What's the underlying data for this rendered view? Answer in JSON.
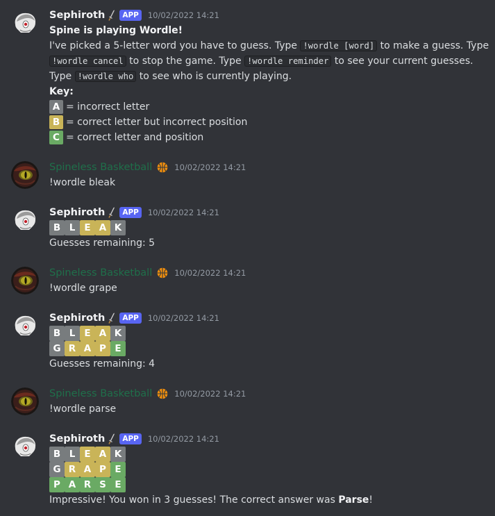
{
  "colors": {
    "background": "#313338",
    "app_badge": "#5865f2",
    "tile_incorrect": "#787c7e",
    "tile_wrong_position": "#c9b458",
    "tile_correct": "#6aaa64",
    "user_name_green": "#1f6f4a"
  },
  "bot": {
    "name": "Sephiroth",
    "badge": "APP",
    "avatar_icon": "sephiroth-avatar-icon"
  },
  "user": {
    "name": "Spineless Basketball",
    "avatar_icon": "spineless-avatar-icon",
    "emoji": "basketball-icon"
  },
  "timestamp": "10/02/2022 14:21",
  "intro": {
    "title": "Spine is playing Wordle!",
    "p1_a": "I've picked a 5-letter word you have to guess. Type ",
    "cmd_guess": "!wordle [word]",
    "p1_b": " to make a guess. Type",
    "cmd_cancel": "!wordle cancel",
    "p2_a": " to stop the game. Type ",
    "cmd_reminder": "!wordle reminder",
    "p2_b": " to see your current guesses.",
    "p3_a": "Type ",
    "cmd_who": "!wordle who",
    "p3_b": " to see who is currently playing.",
    "key_label": "Key:",
    "key": [
      {
        "letter": "A",
        "text": "= incorrect letter"
      },
      {
        "letter": "B",
        "text": "= correct letter but incorrect position"
      },
      {
        "letter": "C",
        "text": "= correct letter and position"
      }
    ]
  },
  "guesses": [
    {
      "command": "!wordle bleak",
      "word": [
        "B",
        "L",
        "E",
        "A",
        "K"
      ],
      "remaining": "Guesses remaining: 5"
    },
    {
      "command": "!wordle grape",
      "word": [
        "G",
        "R",
        "A",
        "P",
        "E"
      ],
      "remaining": "Guesses remaining: 4"
    },
    {
      "command": "!wordle parse",
      "word": [
        "P",
        "A",
        "R",
        "S",
        "E"
      ]
    }
  ],
  "final": {
    "text_a": "Impressive! You won in 3 guesses! The correct answer was ",
    "answer": "Parse",
    "text_b": "!"
  }
}
